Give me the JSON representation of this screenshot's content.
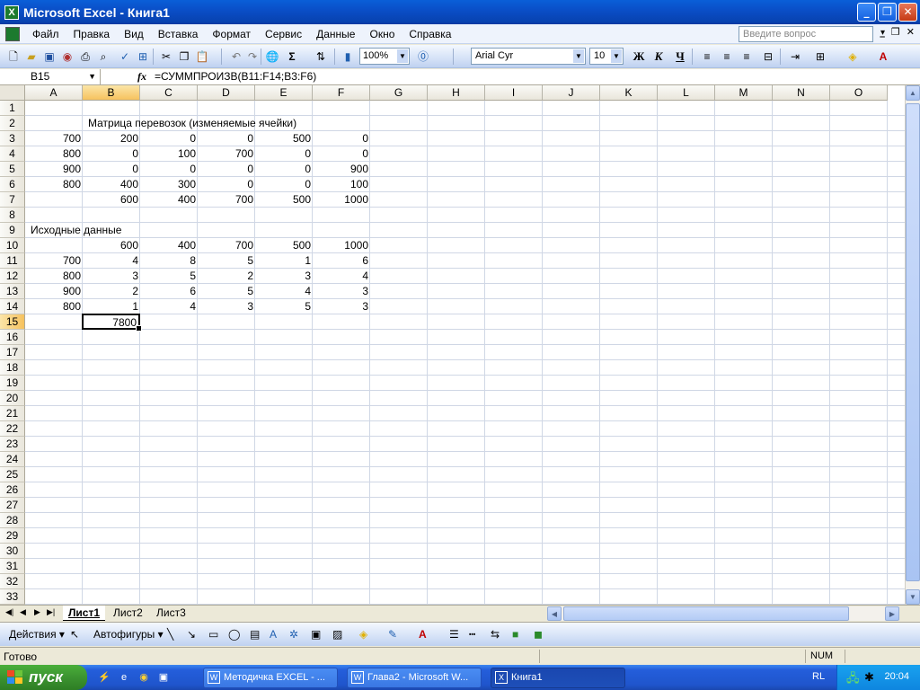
{
  "window": {
    "title": "Microsoft Excel - Книга1"
  },
  "menu": {
    "items": [
      "Файл",
      "Правка",
      "Вид",
      "Вставка",
      "Формат",
      "Сервис",
      "Данные",
      "Окно",
      "Справка"
    ],
    "help_placeholder": "Введите вопрос"
  },
  "toolbar": {
    "zoom": "100%",
    "font": "Arial Cyr",
    "font_size": "10",
    "bold": "Ж",
    "italic": "К",
    "underline": "Ч",
    "sum": "Σ"
  },
  "formula_bar": {
    "name_box": "B15",
    "fx": "fx",
    "formula": "=СУММПРОИЗВ(B11:F14;B3:F6)"
  },
  "grid": {
    "columns": [
      "A",
      "B",
      "C",
      "D",
      "E",
      "F",
      "G",
      "H",
      "I",
      "J",
      "K",
      "L",
      "M",
      "N",
      "O"
    ],
    "selected_column": "B",
    "selected_row": "15",
    "active_cell": "B15",
    "text_cells": [
      {
        "cell": "B2",
        "value": "Матрица перевозок (изменяемые ячейки)"
      },
      {
        "cell": "A9",
        "value": "Исходные данные"
      }
    ],
    "rows": [
      {
        "row": 3,
        "values": [
          "700",
          "200",
          "0",
          "0",
          "500",
          "0"
        ]
      },
      {
        "row": 4,
        "values": [
          "800",
          "0",
          "100",
          "700",
          "0",
          "0"
        ]
      },
      {
        "row": 5,
        "values": [
          "900",
          "0",
          "0",
          "0",
          "0",
          "900"
        ]
      },
      {
        "row": 6,
        "values": [
          "800",
          "400",
          "300",
          "0",
          "0",
          "100"
        ]
      },
      {
        "row": 7,
        "values": [
          "",
          "600",
          "400",
          "700",
          "500",
          "1000"
        ]
      },
      {
        "row": 10,
        "values": [
          "",
          "600",
          "400",
          "700",
          "500",
          "1000"
        ]
      },
      {
        "row": 11,
        "values": [
          "700",
          "4",
          "8",
          "5",
          "1",
          "6"
        ]
      },
      {
        "row": 12,
        "values": [
          "800",
          "3",
          "5",
          "2",
          "3",
          "4"
        ]
      },
      {
        "row": 13,
        "values": [
          "900",
          "2",
          "6",
          "5",
          "4",
          "3"
        ]
      },
      {
        "row": 14,
        "values": [
          "800",
          "1",
          "4",
          "3",
          "5",
          "3"
        ]
      },
      {
        "row": 15,
        "values": [
          "",
          "7800",
          "",
          "",
          "",
          ""
        ]
      }
    ]
  },
  "sheets": {
    "tabs": [
      "Лист1",
      "Лист2",
      "Лист3"
    ],
    "active": "Лист1"
  },
  "draw_toolbar": {
    "actions": "Действия ▾",
    "autoshapes": "Автофигуры ▾"
  },
  "status": {
    "text": "Готово",
    "num": "NUM"
  },
  "taskbar": {
    "start": "пуск",
    "tasks": [
      "Методичка EXCEL - ...",
      "Глава2 - Microsoft W...",
      "Книга1"
    ],
    "lang": "RL",
    "clock": "20:04"
  }
}
